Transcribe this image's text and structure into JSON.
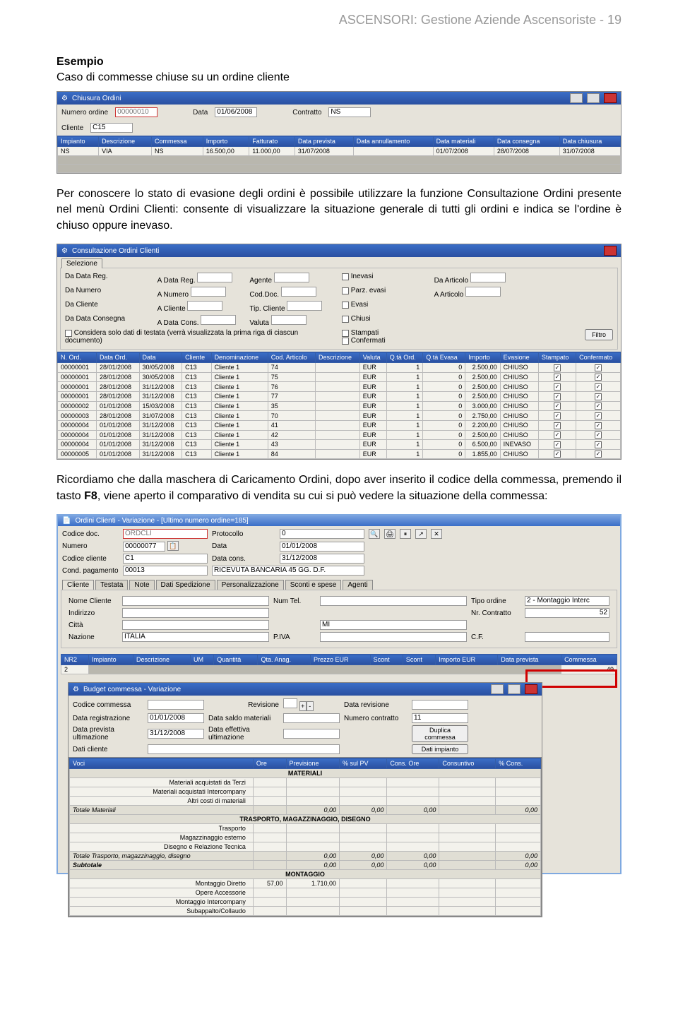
{
  "page_header": "ASCENSORI: Gestione Aziende Ascensoriste - 19",
  "sec1_title": "Esempio",
  "sec1_sub": "Caso di commesse chiuse su un ordine cliente",
  "prose1": "Per conoscere lo stato di evasione degli ordini è possibile utilizzare la funzione Consultazione Ordini presente nel menù Ordini Clienti: consente di visualizzare la situazione generale di tutti gli ordini e indica se l'ordine è chiuso oppure inevaso.",
  "prose2a": "Ricordiamo che dalla maschera di Caricamento Ordini, dopo aver inserito il codice della commessa, premendo il tasto ",
  "prose2b": "F8",
  "prose2c": ", viene aperto il comparativo di vendita su cui si può vedere la situazione della commessa:",
  "shot1": {
    "title": "Chiusura Ordini",
    "fields": {
      "num_ord_lbl": "Numero ordine",
      "num_ord_val": "00000010",
      "data_lbl": "Data",
      "data_val": "01/06/2008",
      "contratto_lbl": "Contratto",
      "contratto_val": "NS",
      "cliente_lbl": "Cliente",
      "cliente_val": "C15"
    },
    "cols": [
      "Impianto",
      "Descrizione",
      "Commessa",
      "Importo",
      "Fatturato",
      "Data prevista",
      "Data annullamento",
      "Data materiali",
      "Data consegna",
      "Data chiusura"
    ],
    "row": [
      "NS",
      "VIA",
      "NS",
      "16.500,00",
      "11.000,00",
      "31/07/2008",
      "",
      "01/07/2008",
      "28/07/2008",
      "31/07/2008"
    ]
  },
  "shot2": {
    "title": "Consultazione Ordini Clienti",
    "sel_tab": "Selezione",
    "filters": {
      "da_data_reg": "Da Data Reg.",
      "a_data_reg": "A Data Reg.",
      "agente": "Agente",
      "da_numero": "Da Numero",
      "a_numero": "A Numero",
      "cod_doc": "Cod.Doc.",
      "da_cliente": "Da Cliente",
      "a_cliente": "A Cliente",
      "tip_cliente": "Tip. Cliente",
      "da_data_cons": "Da Data Consegna",
      "a_data_cons": "A Data Cons.",
      "valuta": "Valuta",
      "inevasi": "Inevasi",
      "parz_evasi": "Parz. evasi",
      "evasi": "Evasi",
      "chiusi": "Chiusi",
      "stampati": "Stampati",
      "confermati": "Confermati",
      "da_articolo": "Da Articolo",
      "a_articolo": "A Articolo",
      "considera": "Considera solo dati di testata (verrà visualizzata la prima riga di ciascun documento)",
      "filtro_btn": "Filtro"
    },
    "cols": [
      "N. Ord.",
      "Data Ord.",
      "Data",
      "Cliente",
      "Denominazione",
      "Cod. Articolo",
      "Descrizione",
      "Valuta",
      "Q.tà Ord.",
      "Q.tà Evasa",
      "Importo",
      "Evasione",
      "Stampato",
      "Confermato"
    ],
    "rows": [
      [
        "00000001",
        "28/01/2008",
        "30/05/2008",
        "C13",
        "Cliente 1",
        "74",
        "",
        "EUR",
        "1",
        "0",
        "2.500,00",
        "CHIUSO",
        "1",
        "1"
      ],
      [
        "00000001",
        "28/01/2008",
        "30/05/2008",
        "C13",
        "Cliente 1",
        "75",
        "",
        "EUR",
        "1",
        "0",
        "2.500,00",
        "CHIUSO",
        "1",
        "1"
      ],
      [
        "00000001",
        "28/01/2008",
        "31/12/2008",
        "C13",
        "Cliente 1",
        "76",
        "",
        "EUR",
        "1",
        "0",
        "2.500,00",
        "CHIUSO",
        "1",
        "1"
      ],
      [
        "00000001",
        "28/01/2008",
        "31/12/2008",
        "C13",
        "Cliente 1",
        "77",
        "",
        "EUR",
        "1",
        "0",
        "2.500,00",
        "CHIUSO",
        "1",
        "1"
      ],
      [
        "00000002",
        "01/01/2008",
        "15/03/2008",
        "C13",
        "Cliente 1",
        "35",
        "",
        "EUR",
        "1",
        "0",
        "3.000,00",
        "CHIUSO",
        "1",
        "1"
      ],
      [
        "00000003",
        "28/01/2008",
        "31/07/2008",
        "C13",
        "Cliente 1",
        "70",
        "",
        "EUR",
        "1",
        "0",
        "2.750,00",
        "CHIUSO",
        "1",
        "1"
      ],
      [
        "00000004",
        "01/01/2008",
        "31/12/2008",
        "C13",
        "Cliente 1",
        "41",
        "",
        "EUR",
        "1",
        "0",
        "2.200,00",
        "CHIUSO",
        "1",
        "1"
      ],
      [
        "00000004",
        "01/01/2008",
        "31/12/2008",
        "C13",
        "Cliente 1",
        "42",
        "",
        "EUR",
        "1",
        "0",
        "2.500,00",
        "CHIUSO",
        "1",
        "1"
      ],
      [
        "00000004",
        "01/01/2008",
        "31/12/2008",
        "C13",
        "Cliente 1",
        "43",
        "",
        "EUR",
        "1",
        "0",
        "6.500,00",
        "INEVASO",
        "1",
        "1"
      ],
      [
        "00000005",
        "01/01/2008",
        "31/12/2008",
        "C13",
        "Cliente 1",
        "84",
        "",
        "EUR",
        "1",
        "0",
        "1.855,00",
        "CHIUSO",
        "1",
        "1"
      ]
    ]
  },
  "shot3": {
    "title": "Ordini Clienti - Variazione - [Ultimo numero ordine=185]",
    "header": {
      "codice_doc_lbl": "Codice doc.",
      "codice_doc_val": "ORDCLI",
      "protocollo_lbl": "Protocollo",
      "protocollo_val": "0",
      "numero_lbl": "Numero",
      "numero_val": "00000077",
      "icon1": "📋",
      "data_lbl": "Data",
      "data_val": "01/01/2008",
      "codice_cliente_lbl": "Codice cliente",
      "codice_cliente_val": "C1",
      "data_cons_lbl": "Data cons.",
      "data_cons_val": "31/12/2008",
      "cond_pag_lbl": "Cond. pagamento",
      "cond_pag_val": "00013",
      "cond_pag_desc": "RICEVUTA BANCARIA 45 GG. D.F."
    },
    "tabs": [
      "Cliente",
      "Testata",
      "Note",
      "Dati Spedizione",
      "Personalizzazione",
      "Sconti e spese",
      "Agenti"
    ],
    "client": {
      "nome_lbl": "Nome Cliente",
      "num_tel_lbl": "Num Tel.",
      "tipo_ord_lbl": "Tipo ordine",
      "tipo_ord_val": "2 - Montaggio Interc",
      "indirizzo_lbl": "Indirizzo",
      "nr_contr_lbl": "Nr. Contratto",
      "nr_contr_val": "52",
      "citta_lbl": "Città",
      "prov_val": "MI",
      "nazione_lbl": "Nazione",
      "nazione_val": "ITALIA",
      "piva_lbl": "P.IVA",
      "cf_lbl": "C.F."
    },
    "grid_cols": [
      "NR2",
      "Impianto",
      "Descrizione",
      "UM",
      "Quantità",
      "Qta. Anag.",
      "Prezzo EUR",
      "Scont",
      "Scont",
      "Importo EUR",
      "Data prevista",
      "Commessa"
    ],
    "grid_row_last": "49",
    "budget": {
      "title": "Budget commessa - Variazione",
      "codice_comm_lbl": "Codice commessa",
      "revisione_lbl": "Revisione",
      "data_rev_lbl": "Data revisione",
      "data_reg_lbl": "Data registrazione",
      "data_reg_val": "01/01/2008",
      "data_saldo_lbl": "Data saldo materiali",
      "num_contr_lbl": "Numero contratto",
      "num_contr_val": "11",
      "data_prev_lbl": "Data prevista ultimazione",
      "data_prev_val": "31/12/2008",
      "data_eff_lbl": "Data effettiva ultimazione",
      "duplica_btn": "Duplica commessa",
      "dati_cliente_lbl": "Dati cliente",
      "dati_imp_btn": "Dati impianto",
      "cols": [
        "Voci",
        "Ore",
        "Previsione",
        "% sul PV",
        "Cons. Ore",
        "Consuntivo",
        "% Cons."
      ],
      "rows": [
        {
          "t": "section",
          "label": "MATERIALI"
        },
        {
          "t": "item",
          "label": "Materiali acquistati da Terzi"
        },
        {
          "t": "item",
          "label": "Materiali acquistati Intercompany"
        },
        {
          "t": "item",
          "label": "Altri costi di materiali"
        },
        {
          "t": "total",
          "label": "Totale Materiali",
          "v": [
            "0,00",
            "0,00",
            "0,00",
            "",
            "0,00"
          ]
        },
        {
          "t": "section",
          "label": "TRASPORTO, MAGAZZINAGGIO, DISEGNO"
        },
        {
          "t": "item",
          "label": "Trasporto"
        },
        {
          "t": "item",
          "label": "Magazzinaggio esterno"
        },
        {
          "t": "item",
          "label": "Disegno e Relazione Tecnica"
        },
        {
          "t": "total",
          "label": "Totale Trasporto, magazzinaggio, disegno",
          "v": [
            "0,00",
            "0,00",
            "0,00",
            "",
            "0,00"
          ]
        },
        {
          "t": "subtotal",
          "label": "Subtotale",
          "v": [
            "0,00",
            "0,00",
            "0,00",
            "",
            "0,00"
          ]
        },
        {
          "t": "section",
          "label": "MONTAGGIO"
        },
        {
          "t": "item",
          "label": "Montaggio Diretto",
          "ore": "57,00",
          "prev": "1.710,00"
        },
        {
          "t": "item",
          "label": "Opere Accessorie"
        },
        {
          "t": "item",
          "label": "Montaggio Intercompany"
        },
        {
          "t": "item",
          "label": "Subappalto/Collaudo"
        }
      ]
    }
  }
}
